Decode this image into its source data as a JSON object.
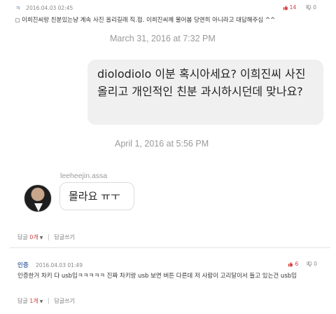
{
  "top_comment": {
    "author": "ㅋ",
    "date": "2016.04.03 02:45",
    "likes": "14",
    "dislikes": "0",
    "body": "이희진씨랑 친분있는냥 계속 사진 올리길래 직.접. 이희진씨께 물어봄 당연히 아니라고 대답해주심 ^^"
  },
  "chat": {
    "timestamp1": "March 31, 2016 at 7:32 PM",
    "outgoing_message": "diolodiolo 이분 혹시아세요? 이희진씨 사진 올리고 개인적인 친분 과시하시던데 맞나요?",
    "timestamp2": "April 1, 2016 at 5:56 PM",
    "sender_name": "leeheejin.assa",
    "incoming_message": "몰라요 ㅠㅜ"
  },
  "reply_bar_1": {
    "label": "답글",
    "count": "0개",
    "write": "답글쓰기"
  },
  "second_comment": {
    "author": "인증",
    "date": "2016.04.03 01:49",
    "likes": "6",
    "dislikes": "0",
    "body": "인증한거 차키 다 usb임ㅋㅋㅋㅋㅋ 진짜 차키랑 usb 보면 버튼 다른데 저 사람이 고리달이서 들고 있는건 usb임"
  },
  "reply_bar_2": {
    "label": "답글",
    "count": "1개",
    "write": "답글쓰기"
  },
  "colors": {
    "like": "#d23b3b",
    "author": "#4a6fa5",
    "bubble_out": "#f0f0f0"
  },
  "icons": {
    "like": "thumbs-up-icon",
    "dislike": "thumbs-down-icon"
  }
}
